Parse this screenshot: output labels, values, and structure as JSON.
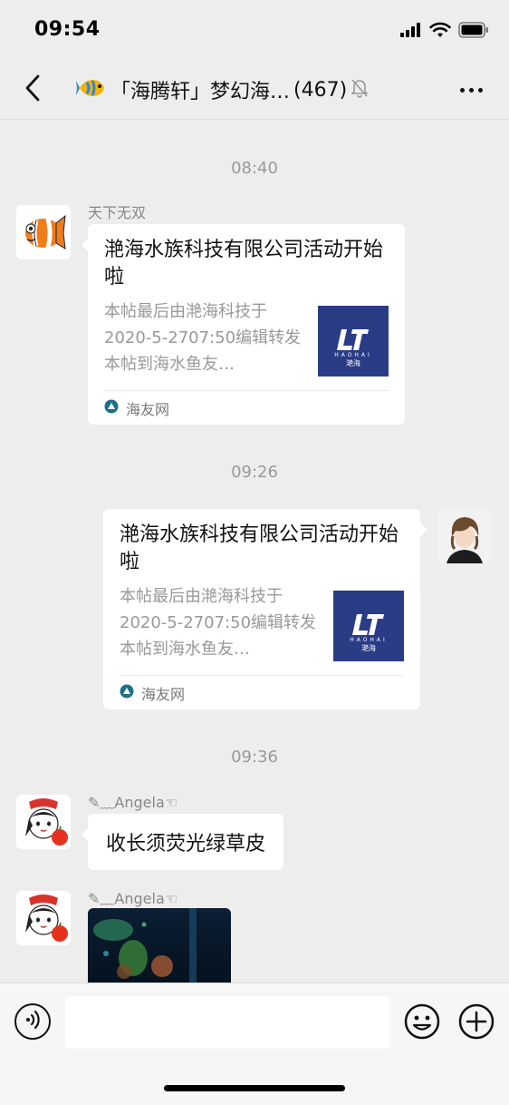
{
  "status_bar": {
    "time": "09:54"
  },
  "nav": {
    "title": "「海腾轩」梦幻海…",
    "member_count": "(467)"
  },
  "messages": [
    {
      "type": "timestamp",
      "text": "08:40"
    },
    {
      "type": "link_card",
      "side": "left",
      "sender": "天下无双",
      "title": "滟海水族科技有限公司活动开始啦",
      "description": "本帖最后由滟海科技于2020-5-2707:50编辑转发本帖到海水鱼友…",
      "thumb_text": "HAOHAI",
      "thumb_cn": "滟海",
      "source": "海友网"
    },
    {
      "type": "timestamp",
      "text": "09:26"
    },
    {
      "type": "link_card",
      "side": "right",
      "title": "滟海水族科技有限公司活动开始啦",
      "description": "本帖最后由滟海科技于2020-5-2707:50编辑转发本帖到海水鱼友…",
      "thumb_text": "HAOHAI",
      "thumb_cn": "滟海",
      "source": "海友网"
    },
    {
      "type": "timestamp",
      "text": "09:36"
    },
    {
      "type": "text",
      "side": "left",
      "sender": "✎﹏Angela☜",
      "text": "收长须荧光绿草皮"
    },
    {
      "type": "image",
      "side": "left",
      "sender": "✎﹏Angela☜"
    }
  ],
  "input_bar": {
    "placeholder": ""
  },
  "colors": {
    "background": "#ededed",
    "bubble": "#ffffff",
    "thumb_bg": "#2b3c86",
    "timestamp": "#9a9a9a"
  }
}
